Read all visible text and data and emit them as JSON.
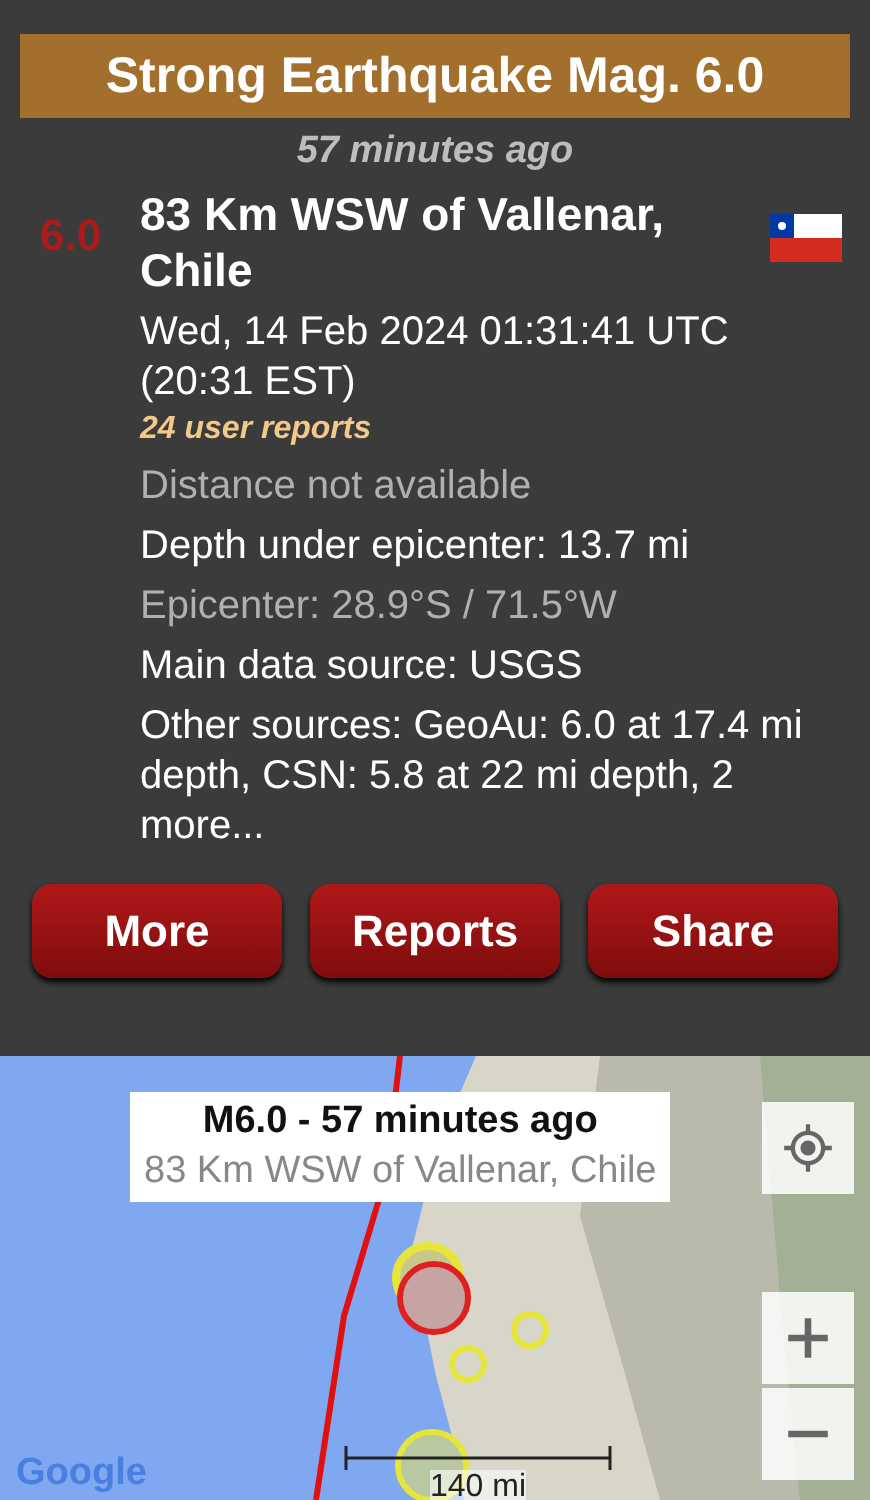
{
  "header": {
    "title": "Strong Earthquake Mag. 6.0"
  },
  "time_ago": "57 minutes ago",
  "event": {
    "magnitude": "6.0",
    "location": "83 Km WSW of Vallenar, Chile",
    "datetime": "Wed, 14 Feb 2024 01:31:41 UTC (20:31 EST)",
    "user_reports": "24 user reports"
  },
  "details": [
    {
      "text": "Distance not available",
      "dimmed": true
    },
    {
      "text": "Depth under epicenter: 13.7 mi",
      "dimmed": false
    },
    {
      "text": "Epicenter: 28.9°S / 71.5°W",
      "dimmed": true
    },
    {
      "text": "Main data source: USGS",
      "dimmed": false
    },
    {
      "text": "Other sources: GeoAu: 6.0 at 17.4 mi depth, CSN: 5.8 at 22 mi depth, 2 more...",
      "dimmed": false
    }
  ],
  "buttons": [
    "More",
    "Reports",
    "Share"
  ],
  "map": {
    "kind": "picture",
    "popup": {
      "title": "M6.0  -  57 minutes ago",
      "subtitle": "83 Km WSW of Vallenar, Chile"
    },
    "scale": "140 mi",
    "attribution": "Google"
  }
}
